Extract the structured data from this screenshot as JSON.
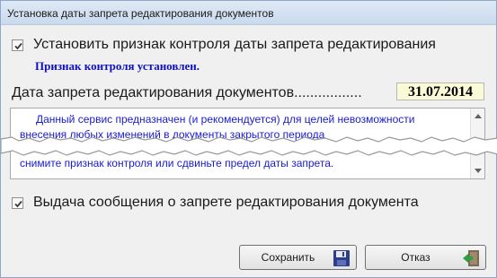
{
  "window": {
    "title": "Установка даты запрета редактирования документов"
  },
  "control_flag": {
    "label": "Установить признак контроля даты запрета редактирования",
    "checked": true,
    "status_text": "Признак контроля установлен."
  },
  "lock_date": {
    "label": "Дата запрета редактирования документов.................",
    "value": "31.07.2014"
  },
  "info_memo": {
    "lines": [
      "Данный сервис предназначен (и рекомендуется) для целей невозможности",
      "внесения любых изменений в документы закрытого периода",
      "снимите признак контроля или сдвиньте предел даты запрета."
    ]
  },
  "message_flag": {
    "label": "Выдача сообщения о запрете редактирования документа",
    "checked": true
  },
  "buttons": {
    "save_label": "Сохранить",
    "cancel_label": "Отказ",
    "save_icon": "floppy-disk-icon",
    "cancel_icon": "exit-door-icon"
  },
  "colors": {
    "status_text": "#1010c0",
    "memo_text": "#1a1ad0",
    "date_field_bg": "#fafad6"
  }
}
